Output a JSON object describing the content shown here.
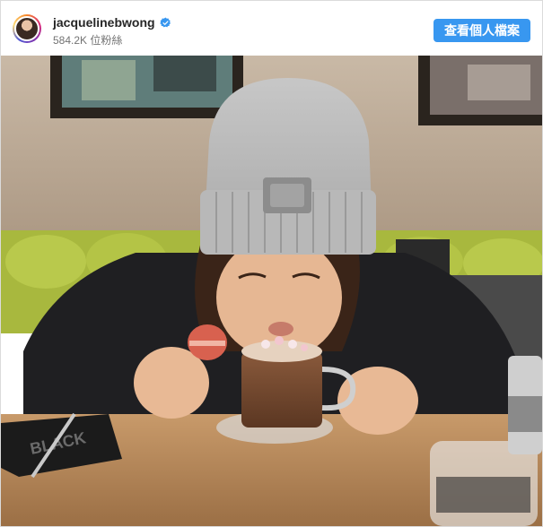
{
  "post_header": {
    "username": "jacquelinebwong",
    "followers": "584.2K 位粉絲",
    "verified_icon": "verified-badge-icon",
    "view_profile_label": "查看個人檔案"
  },
  "colors": {
    "button_blue": "#3897f0",
    "verified_blue": "#3897f0",
    "username_text": "#262626",
    "secondary_text": "#737373"
  },
  "photo": {
    "subject": "post-photo",
    "mug_text": "BLACK"
  }
}
